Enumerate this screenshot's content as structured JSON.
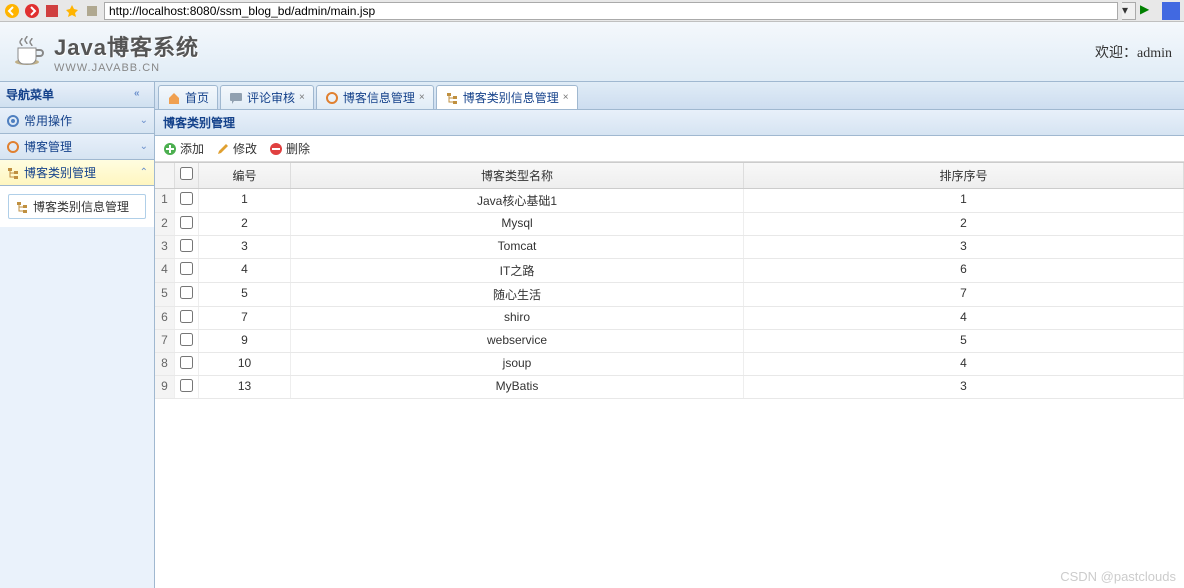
{
  "browser": {
    "url": "http://localhost:8080/ssm_blog_bd/admin/main.jsp"
  },
  "header": {
    "title": "Java博客系统",
    "subtitle": "WWW.JAVABB.CN",
    "welcome": "欢迎：",
    "user": "admin"
  },
  "sidebar": {
    "nav_title": "导航菜单",
    "items": [
      {
        "label": "常用操作",
        "icon": "gear"
      },
      {
        "label": "博客管理",
        "icon": "circle"
      },
      {
        "label": "博客类别管理",
        "icon": "tree"
      }
    ],
    "tree_item": "博客类别信息管理"
  },
  "tabs": [
    {
      "label": "首页",
      "icon": "home",
      "closable": false
    },
    {
      "label": "评论审核",
      "icon": "comment",
      "closable": true
    },
    {
      "label": "博客信息管理",
      "icon": "circle",
      "closable": true
    },
    {
      "label": "博客类别信息管理",
      "icon": "tree",
      "closable": true,
      "active": true
    }
  ],
  "panel": {
    "title": "博客类别管理"
  },
  "toolbar": {
    "add": "添加",
    "edit": "修改",
    "delete": "删除"
  },
  "table": {
    "headers": {
      "id": "编号",
      "name": "博客类型名称",
      "sort": "排序序号"
    },
    "rows": [
      {
        "idx": "1",
        "id": "1",
        "name": "Java核心基础1",
        "sort": "1"
      },
      {
        "idx": "2",
        "id": "2",
        "name": "Mysql",
        "sort": "2"
      },
      {
        "idx": "3",
        "id": "3",
        "name": "Tomcat",
        "sort": "3"
      },
      {
        "idx": "4",
        "id": "4",
        "name": "IT之路",
        "sort": "6"
      },
      {
        "idx": "5",
        "id": "5",
        "name": "随心生活",
        "sort": "7"
      },
      {
        "idx": "6",
        "id": "7",
        "name": "shiro",
        "sort": "4"
      },
      {
        "idx": "7",
        "id": "9",
        "name": "webservice",
        "sort": "5"
      },
      {
        "idx": "8",
        "id": "10",
        "name": "jsoup",
        "sort": "4"
      },
      {
        "idx": "9",
        "id": "13",
        "name": "MyBatis",
        "sort": "3"
      }
    ]
  },
  "watermark": "CSDN @pastclouds"
}
